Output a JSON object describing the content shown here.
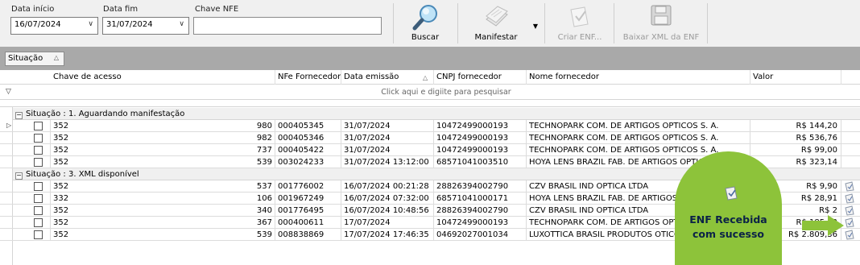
{
  "filters": {
    "data_inicio_label": "Data início",
    "data_inicio_value": "16/07/2024",
    "data_fim_label": "Data fim",
    "data_fim_value": "31/07/2024",
    "chave_nfe_label": "Chave NFE",
    "chave_nfe_value": ""
  },
  "toolbar": {
    "buscar": "Buscar",
    "manifestar": "Manifestar",
    "criar_enf": "Criar ENF...",
    "baixar_xml": "Baixar XML da ENF"
  },
  "group_panel": {
    "chip": "Situação"
  },
  "columns": {
    "chave": "Chave de acesso",
    "nfe": "NFe Fornecedor",
    "data": "Data emissão",
    "cnpj": "CNPJ fornecedor",
    "nome": "Nome fornecedor",
    "valor": "Valor"
  },
  "filter_placeholder": "Click aqui e digiite para pesquisar",
  "groups": [
    {
      "title": "Situação : 1. Aguardando manifestação",
      "rows": [
        {
          "chave": "352",
          "num": "980",
          "nfe": "000405345",
          "data": "31/07/2024",
          "cnpj": "10472499000193",
          "nome": "TECHNOPARK COM. DE ARTIGOS OPTICOS S. A.",
          "valor": "R$ 144,20"
        },
        {
          "chave": "352",
          "num": "982",
          "nfe": "000405346",
          "data": "31/07/2024",
          "cnpj": "10472499000193",
          "nome": "TECHNOPARK COM. DE ARTIGOS OPTICOS S. A.",
          "valor": "R$ 536,76"
        },
        {
          "chave": "352",
          "num": "737",
          "nfe": "000405422",
          "data": "31/07/2024",
          "cnpj": "10472499000193",
          "nome": "TECHNOPARK COM. DE ARTIGOS OPTICOS S. A.",
          "valor": "R$ 99,00"
        },
        {
          "chave": "352",
          "num": "539",
          "nfe": "003024233",
          "data": "31/07/2024 13:12:00",
          "cnpj": "68571041003510",
          "nome": "HOYA LENS BRAZIL FAB. DE ARTIGOS OPTICOS",
          "valor": "R$ 323,14"
        }
      ]
    },
    {
      "title": "Situação : 3. XML disponível",
      "rows": [
        {
          "chave": "352",
          "num": "537",
          "nfe": "001776002",
          "data": "16/07/2024 00:21:28",
          "cnpj": "28826394002790",
          "nome": "CZV BRASIL IND OPTICA LTDA",
          "valor": "R$ 9,90"
        },
        {
          "chave": "332",
          "num": "106",
          "nfe": "001967249",
          "data": "16/07/2024 07:32:00",
          "cnpj": "68571041000171",
          "nome": "HOYA LENS BRAZIL FAB. DE ARTIGOS OPTICOS",
          "valor": "R$ 28,91"
        },
        {
          "chave": "352",
          "num": "340",
          "nfe": "001776495",
          "data": "16/07/2024 10:48:56",
          "cnpj": "28826394002790",
          "nome": "CZV BRASIL IND OPTICA LTDA",
          "valor": "R$ 2"
        },
        {
          "chave": "352",
          "num": "367",
          "nfe": "000400611",
          "data": "17/07/2024",
          "cnpj": "10472499000193",
          "nome": "TECHNOPARK COM. DE ARTIGOS OPTICOS S. A.",
          "valor": "R$ 185,82"
        },
        {
          "chave": "352",
          "num": "539",
          "nfe": "008838869",
          "data": "17/07/2024 17:46:35",
          "cnpj": "04692027001034",
          "nome": "LUXOTTICA BRASIL PRODUTOS OTICOS E ESPORTIVOS",
          "valor": "R$ 2.809,36"
        }
      ]
    }
  ],
  "toast": {
    "line1": "ENF Recebida",
    "line2": "com sucesso",
    "color": "#8dc33a"
  },
  "icons": {
    "buscar": "magnifier-icon",
    "manifestar": "document-stack-icon",
    "criar": "document-check-icon",
    "baixar": "floppy-disk-icon"
  }
}
